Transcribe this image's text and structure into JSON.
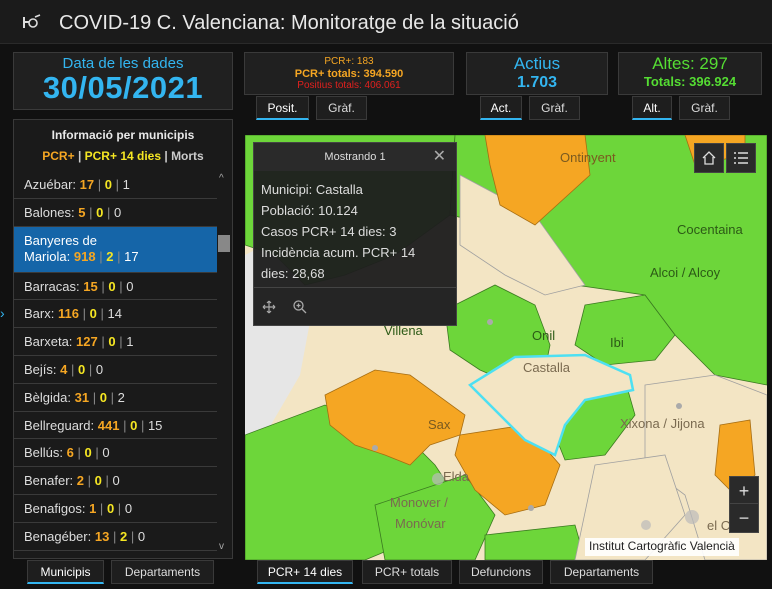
{
  "header": {
    "title": "COVID-19 C. Valenciana: Monitoratge de la situació"
  },
  "date_panel": {
    "label": "Data de les dades",
    "value": "30/05/2021"
  },
  "pcr_panel": {
    "line1": "PCR+: 183",
    "line2": "PCR+ totals: 394.590",
    "line3": "Positius totals: 406.061"
  },
  "pcr_tabs": [
    "Posit.",
    "Gràf."
  ],
  "active_panel": {
    "label": "Actius",
    "value": "1.703"
  },
  "active_tabs": [
    "Act.",
    "Gràf."
  ],
  "altes_panel": {
    "label": "Altes: 297",
    "totals": "Totals: 396.924"
  },
  "altes_tabs": [
    "Alt.",
    "Gràf."
  ],
  "municipality_list": {
    "title": "Informació per municipis",
    "legend": {
      "a": "PCR+",
      "sep": "|",
      "b": "PCR+ 14 dies",
      "c": "Morts"
    },
    "rows": [
      {
        "name": "Azuébar:",
        "a": "17",
        "b": "0",
        "c": "1"
      },
      {
        "name": "Balones:",
        "a": "5",
        "b": "0",
        "c": "0"
      },
      {
        "name": "Banyeres de",
        "name2": "Mariola:",
        "a": "918",
        "b": "2",
        "c": "17",
        "selected": true
      },
      {
        "name": "Barracas:",
        "a": "15",
        "b": "0",
        "c": "0"
      },
      {
        "name": "Barx:",
        "a": "116",
        "b": "0",
        "c": "14"
      },
      {
        "name": "Barxeta:",
        "a": "127",
        "b": "0",
        "c": "1"
      },
      {
        "name": "Bejís:",
        "a": "4",
        "b": "0",
        "c": "0"
      },
      {
        "name": "Bèlgida:",
        "a": "31",
        "b": "0",
        "c": "2"
      },
      {
        "name": "Bellreguard:",
        "a": "441",
        "b": "0",
        "c": "15"
      },
      {
        "name": "Bellús:",
        "a": "6",
        "b": "0",
        "c": "0"
      },
      {
        "name": "Benafer:",
        "a": "2",
        "b": "0",
        "c": "0"
      },
      {
        "name": "Benafigos:",
        "a": "1",
        "b": "0",
        "c": "0"
      },
      {
        "name": "Benagéber:",
        "a": "13",
        "b": "2",
        "c": "0"
      }
    ]
  },
  "list_tabs": [
    "Municipis",
    "Departaments"
  ],
  "map_tabs": [
    "PCR+ 14 dies",
    "PCR+ totals",
    "Defuncions",
    "Departaments"
  ],
  "popup": {
    "title": "Mostrando 1",
    "lines": [
      "Municipi: Castalla",
      "Població: 10.124",
      "Casos PCR+ 14 dies: 3",
      "Incidència acum. PCR+ 14",
      "dies: 28,68"
    ]
  },
  "map_labels": [
    "Ontinyent",
    "Cocentaina",
    "Alcoi / Alcoy",
    "Onil",
    "Ibi",
    "Castalla",
    "Villena",
    "Sax",
    "Xixona / Jijona",
    "Elda",
    "Monover /",
    "Monóvar",
    "el C"
  ],
  "attribution": "Institut Cartogràfic Valencià",
  "colors": {
    "accent": "#33b5f0",
    "orange": "#f5a623",
    "green": "#6dd63a",
    "beige": "#f3e5c4"
  }
}
